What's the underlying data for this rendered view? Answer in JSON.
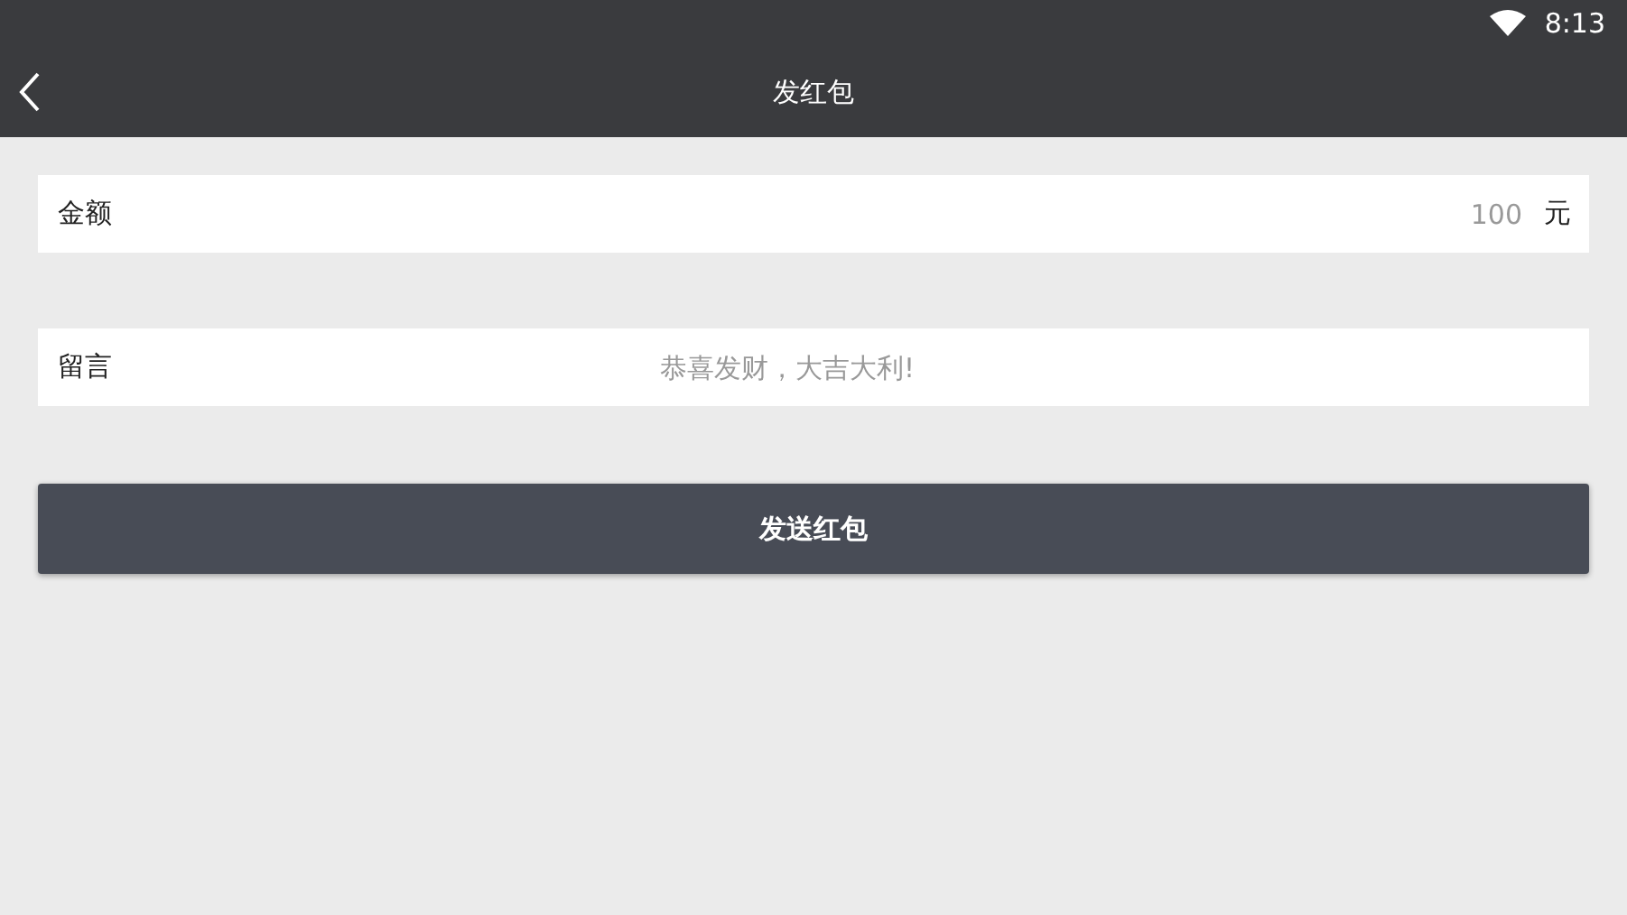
{
  "status_bar": {
    "time": "8:13"
  },
  "header": {
    "title": "发红包"
  },
  "amount": {
    "label": "金额",
    "placeholder": "100",
    "unit": "元"
  },
  "message": {
    "label": "留言",
    "placeholder": "恭喜发财，大吉大利!"
  },
  "send_button": {
    "label": "发送红包"
  }
}
